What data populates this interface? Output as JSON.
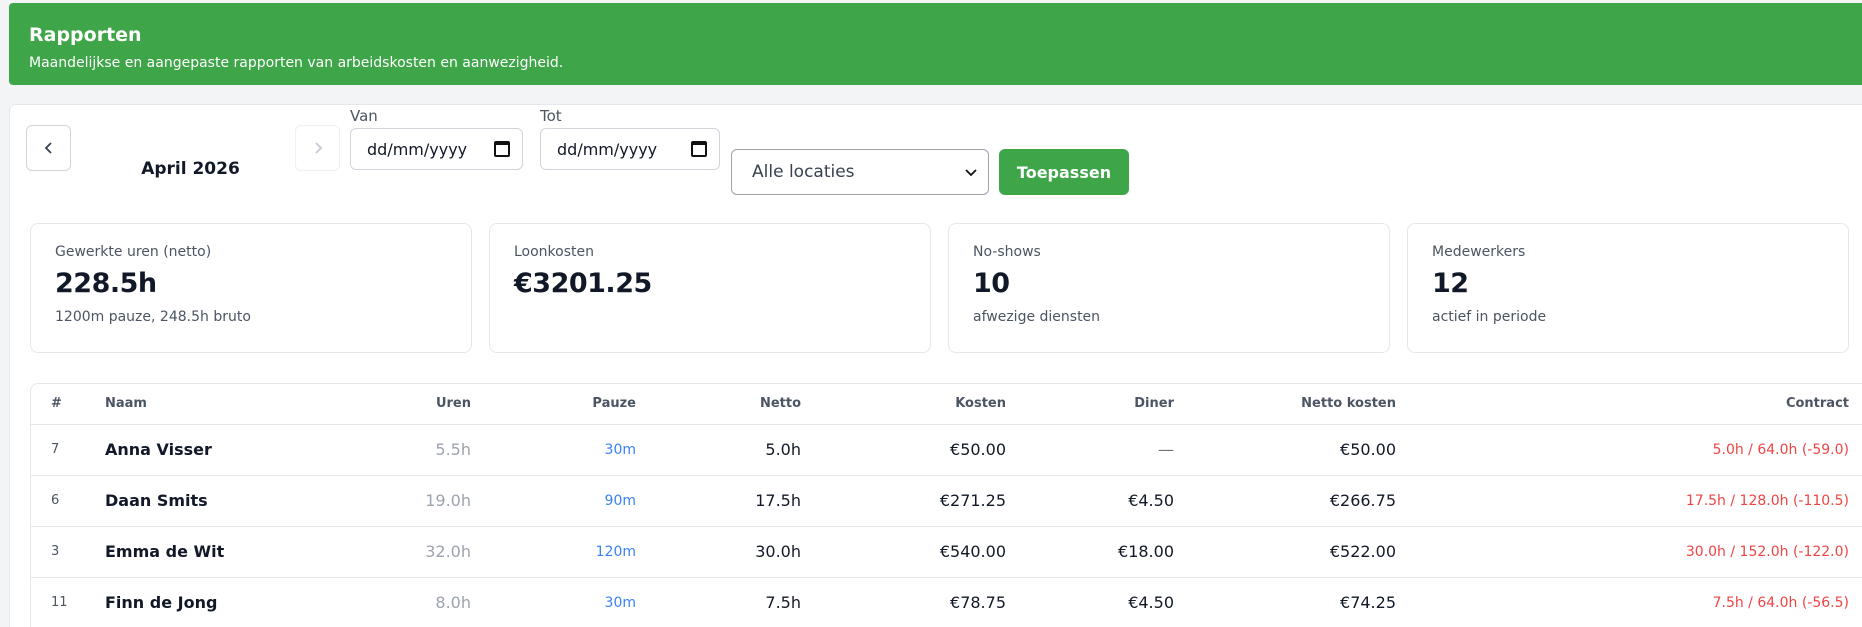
{
  "header": {
    "title": "Rapporten",
    "subtitle": "Maandelijkse en aangepaste rapporten van arbeidskosten en aanwezigheid."
  },
  "filters": {
    "prev_icon": "chevron-left-icon",
    "next_icon": "chevron-right-icon",
    "month": "April 2026",
    "from_label": "Van",
    "from_placeholder": "dd/mm/yyyy",
    "to_label": "Tot",
    "to_placeholder": "dd/mm/yyyy",
    "location_selected": "Alle locaties",
    "apply_label": "Toepassen"
  },
  "stats": [
    {
      "label": "Gewerkte uren (netto)",
      "value": "228.5h",
      "sub": "1200m pauze, 248.5h bruto"
    },
    {
      "label": "Loonkosten",
      "value": "€3201.25",
      "sub": ""
    },
    {
      "label": "No-shows",
      "value": "10",
      "sub": "afwezige diensten"
    },
    {
      "label": "Medewerkers",
      "value": "12",
      "sub": "actief in periode"
    }
  ],
  "table": {
    "columns": {
      "idx": "#",
      "name": "Naam",
      "uren": "Uren",
      "pauze": "Pauze",
      "netto": "Netto",
      "kosten": "Kosten",
      "diner": "Diner",
      "netto_kosten": "Netto kosten",
      "contract": "Contract"
    },
    "rows": [
      {
        "idx": "7",
        "name": "Anna Visser",
        "uren": "5.5h",
        "pauze": "30m",
        "netto": "5.0h",
        "kosten": "€50.00",
        "diner": "—",
        "netto_kosten": "€50.00",
        "contract": "5.0h / 64.0h (-59.0)"
      },
      {
        "idx": "6",
        "name": "Daan Smits",
        "uren": "19.0h",
        "pauze": "90m",
        "netto": "17.5h",
        "kosten": "€271.25",
        "diner": "€4.50",
        "netto_kosten": "€266.75",
        "contract": "17.5h / 128.0h (-110.5)"
      },
      {
        "idx": "3",
        "name": "Emma de Wit",
        "uren": "32.0h",
        "pauze": "120m",
        "netto": "30.0h",
        "kosten": "€540.00",
        "diner": "€18.00",
        "netto_kosten": "€522.00",
        "contract": "30.0h / 152.0h (-122.0)"
      },
      {
        "idx": "11",
        "name": "Finn de Jong",
        "uren": "8.0h",
        "pauze": "30m",
        "netto": "7.5h",
        "kosten": "€78.75",
        "diner": "€4.50",
        "netto_kosten": "€74.25",
        "contract": "7.5h / 64.0h (-56.5)"
      }
    ]
  },
  "colors": {
    "brand": "#3ea548",
    "contract_warning": "#ef4444",
    "pauze": "#3b82f6"
  }
}
